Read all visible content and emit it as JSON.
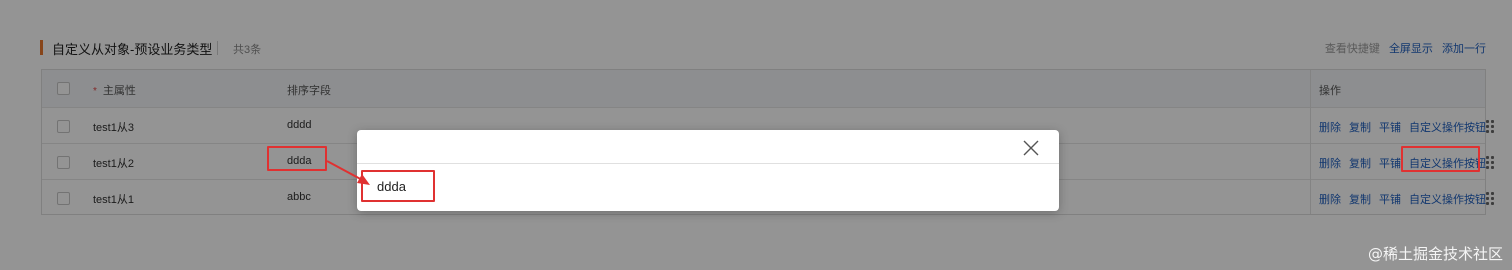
{
  "section": {
    "title": "自定义从对象-预设业务类型",
    "count": "共3条",
    "actions": [
      "查看快捷键",
      "全屏显示",
      "添加一行"
    ]
  },
  "table": {
    "headers": {
      "required_mark": "*",
      "main": "主属性",
      "sort": "排序字段",
      "ops": "操作"
    },
    "rows": [
      {
        "main": "test1从3",
        "sort": "dddd"
      },
      {
        "main": "test1从2",
        "sort": "ddda"
      },
      {
        "main": "test1从1",
        "sort": "abbc"
      }
    ],
    "row_actions": [
      "删除",
      "复制",
      "平铺",
      "自定义操作按钮"
    ]
  },
  "modal": {
    "value": "ddda"
  },
  "colors": {
    "accent_bar": "#e8772e",
    "link": "#1f5fbf",
    "highlight": "#e03131",
    "overlay": "rgba(0,0,0,0.42)"
  },
  "watermark": "@稀土掘金技术社区"
}
